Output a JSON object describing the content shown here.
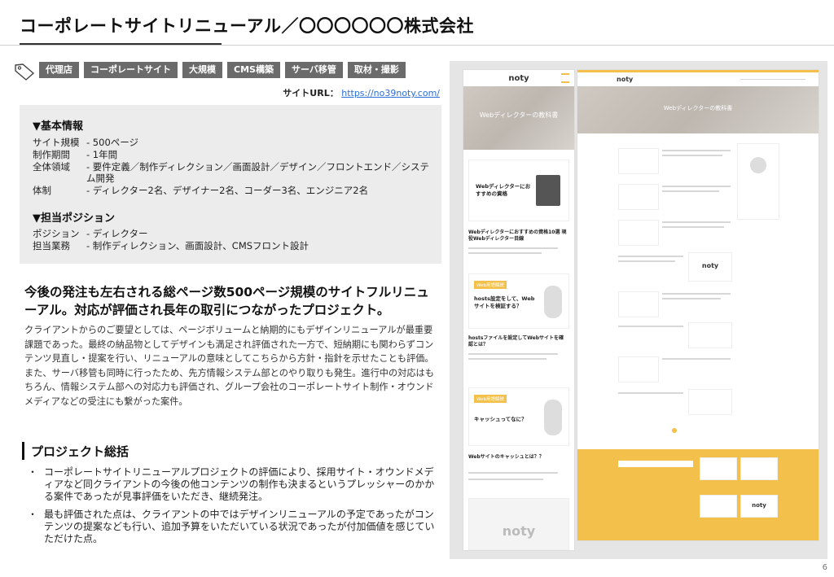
{
  "title": "コーポレートサイトリニューアル／〇〇〇〇〇〇株式会社",
  "tags": [
    "代理店",
    "コーポレートサイト",
    "大規模",
    "CMS構築",
    "サーバ移管",
    "取材・撮影"
  ],
  "site_url": {
    "label": "サイトURL：",
    "value": "https://no39noty.com/"
  },
  "basic_info": {
    "heading": "▼基本情報",
    "rows": [
      {
        "k": "サイト規模",
        "v": "- 500ページ"
      },
      {
        "k": "制作期間",
        "v": "- 1年間"
      },
      {
        "k": "全体領域",
        "v": "- 要件定義／制作ディレクション／画面設計／デザイン／フロントエンド／システム開発"
      },
      {
        "k": "体制",
        "v": "- ディレクター2名、デザイナー2名、コーダー3名、エンジニア2名"
      }
    ]
  },
  "position_info": {
    "heading": "▼担当ポジション",
    "rows": [
      {
        "k": "ポジション",
        "v": "- ディレクター"
      },
      {
        "k": "担当業務",
        "v": "- 制作ディレクション、画面設計、CMSフロント設計"
      }
    ]
  },
  "headline": "今後の発注も左右される総ページ数500ページ規模のサイトフルリニューアル。対応が評価され長年の取引につながったプロジェクト。",
  "body": [
    "クライアントからのご要望としては、ページボリュームと納期的にもデザインリニューアルが最重要課題であった。最終の納品物としてデザインも満足され評価された一方で、短納期にも関わらずコンテンツ見直し・提案を行い、リニューアルの意味としてこちらから方針・指針を示せたことも評価。",
    "また、サーバ移管も同時に行ったため、先方情報システム部とのやり取りも発生。進行中の対応はもちろん、情報システム部への対応力も評価され、グループ会社のコーポレートサイト制作・オウンドメディアなどの受注にも繋がった案件。"
  ],
  "summary": {
    "heading": "プロジェクト総括",
    "bullets": [
      "コーポレートサイトリニューアルプロジェクトの評価により、採用サイト・オウンドメディアなど同クライアントの今後の他コンテンツの制作も決まるというプレッシャーのかかる案件であったが見事評価をいただき、継続発注。",
      "最も評価された点は、クライアントの中ではデザインリニューアルの予定であったがコンテンツの提案なども行い、追加予算をいただいている状況であったが付加価値を感じていただけた点。"
    ]
  },
  "page_number": "6",
  "screenshot": {
    "mobile": {
      "logo": "noty",
      "hero_title": "Webディレクターの教科書",
      "card1_title": "Webディレクターにおすすめの資格",
      "article1": "Webディレクターにおすすめの資格10選 現役Webディレクター目線",
      "badge": "Web用語解説",
      "card2_title": "hosts設定をして、Webサイトを検証する？",
      "article2": "hostsファイルを設定してWebサイトを確認とは？",
      "card3_title": "キャッシュってなに？",
      "article3": "Webサイトのキャッシュとは？？",
      "footer_logo": "noty"
    },
    "desktop": {
      "logo": "noty",
      "hero_title": "Webディレクターの教科書",
      "post_logo": "noty",
      "footer_logo": "noty"
    }
  }
}
